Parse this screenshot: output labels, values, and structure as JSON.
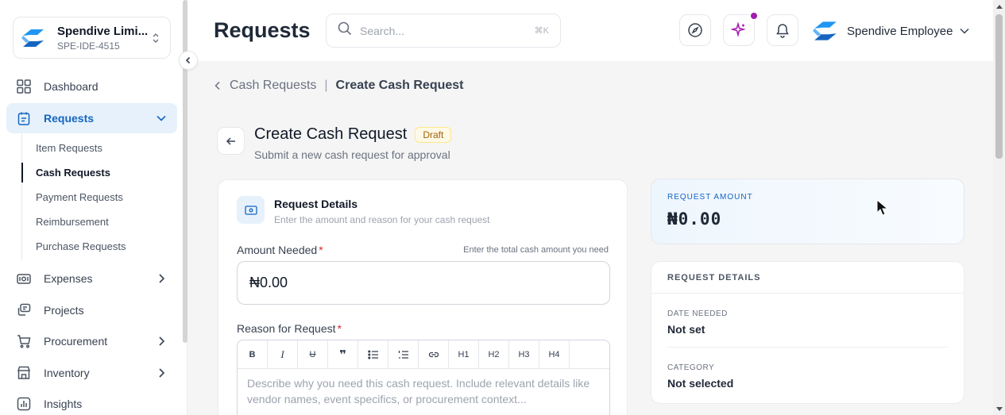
{
  "org": {
    "name": "Spendive Limi...",
    "id": "SPE-IDE-4515"
  },
  "nav": {
    "dashboard": "Dashboard",
    "requests": "Requests",
    "sub": [
      "Item Requests",
      "Cash Requests",
      "Payment Requests",
      "Reimbursement",
      "Purchase Requests"
    ],
    "expenses": "Expenses",
    "projects": "Projects",
    "procurement": "Procurement",
    "inventory": "Inventory",
    "insights": "Insights"
  },
  "header": {
    "title": "Requests",
    "search_placeholder": "Search...",
    "shortcut": "⌘K",
    "user_name": "Spendive Employee"
  },
  "breadcrumb": {
    "parent": "Cash Requests",
    "current": "Create Cash Request"
  },
  "form": {
    "title": "Create Cash Request",
    "status": "Draft",
    "subtitle": "Submit a new cash request for approval",
    "card_title": "Request Details",
    "card_subtitle": "Enter the amount and reason for your cash request",
    "amount_label": "Amount Needed",
    "amount_hint": "Enter the total cash amount you need",
    "amount_value": "₦0.00",
    "reason_label": "Reason for Request",
    "required_mark": "*",
    "toolbar": [
      "B",
      "I",
      "U",
      "❞",
      "",
      "",
      "",
      "H1",
      "H2",
      "H3",
      "H4"
    ],
    "reason_placeholder": "Describe why you need this cash request. Include relevant details like vendor names, event specifics, or procurement context..."
  },
  "summary": {
    "amount_label": "REQUEST AMOUNT",
    "amount_value": "₦0.00",
    "details_heading": "REQUEST DETAILS",
    "date_label": "DATE NEEDED",
    "date_value": "Not set",
    "category_label": "CATEGORY",
    "category_value": "Not selected"
  },
  "colors": {
    "accent": "#1565c0",
    "active_bg": "#e6f1fb",
    "notification_dot": "#a21caf",
    "draft_badge": "#a16207"
  }
}
